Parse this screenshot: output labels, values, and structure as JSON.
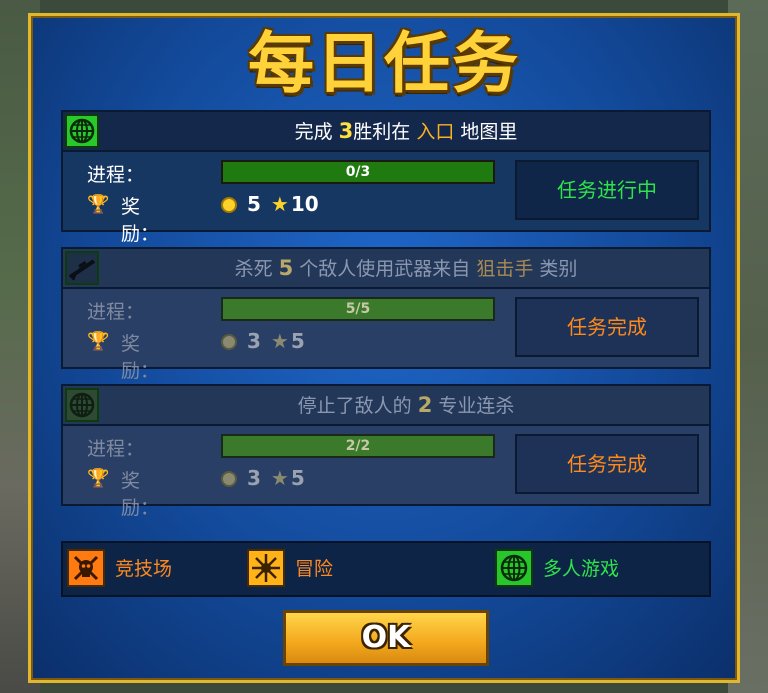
{
  "title": "每日任务",
  "missions": [
    {
      "icon": "multiplayer-globe-icon",
      "text_before": "完成 ",
      "count": "3",
      "text_mid": "胜利在 ",
      "highlight": "入口",
      "text_after": " 地图里",
      "progress_label": "进程：",
      "progress_text": "0/3",
      "progress_fraction": 0.0,
      "reward_label": "奖励：",
      "coins": "5",
      "stars": "10",
      "status": "任务进行中",
      "completed": false
    },
    {
      "icon": "sniper-rifle-icon",
      "text_before": "杀死 ",
      "count": "5",
      "text_mid": " 个敌人使用武器来自 ",
      "highlight": "狙击手",
      "text_after": " 类别",
      "progress_label": "进程：",
      "progress_text": "5/5",
      "progress_fraction": 1.0,
      "reward_label": "奖励：",
      "coins": "3",
      "stars": "5",
      "status": "任务完成",
      "completed": true
    },
    {
      "icon": "multiplayer-globe-icon",
      "text_before": "停止了敌人的 ",
      "count": "2",
      "text_mid": " 专业连杀",
      "highlight": "",
      "text_after": "",
      "progress_label": "进程：",
      "progress_text": "2/2",
      "progress_fraction": 1.0,
      "reward_label": "奖励：",
      "coins": "3",
      "stars": "5",
      "status": "任务完成",
      "completed": true
    }
  ],
  "categories": [
    {
      "icon": "arena-skull-icon",
      "label": "竞技场",
      "color": "#ff8a1c"
    },
    {
      "icon": "adventure-burst-icon",
      "label": "冒险",
      "color": "#ff8a1c"
    },
    {
      "icon": "multiplayer-globe-icon",
      "label": "多人游戏",
      "color": "#2ee34a"
    }
  ],
  "ok_label": "OK",
  "colors": {
    "title": "#ffd23a",
    "in_progress": "#2ee34a",
    "completed": "#ff8a1c",
    "highlight": "#ffb020"
  }
}
